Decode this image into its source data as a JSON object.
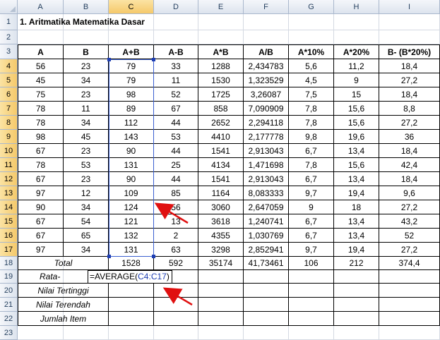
{
  "columns": [
    "A",
    "B",
    "C",
    "D",
    "E",
    "F",
    "G",
    "H",
    "I"
  ],
  "rows": [
    "1",
    "2",
    "3",
    "4",
    "5",
    "6",
    "7",
    "8",
    "9",
    "10",
    "11",
    "12",
    "13",
    "14",
    "15",
    "16",
    "17",
    "18",
    "19",
    "20",
    "21",
    "22",
    "23"
  ],
  "title": "1. Aritmatika Matematika Dasar",
  "table_headers": [
    "A",
    "B",
    "A+B",
    "A-B",
    "A*B",
    "A/B",
    "A*10%",
    "A*20%",
    "B- (B*20%)"
  ],
  "table_rows": [
    [
      "56",
      "23",
      "79",
      "33",
      "1288",
      "2,434783",
      "5,6",
      "11,2",
      "18,4"
    ],
    [
      "45",
      "34",
      "79",
      "11",
      "1530",
      "1,323529",
      "4,5",
      "9",
      "27,2"
    ],
    [
      "75",
      "23",
      "98",
      "52",
      "1725",
      "3,26087",
      "7,5",
      "15",
      "18,4"
    ],
    [
      "78",
      "11",
      "89",
      "67",
      "858",
      "7,090909",
      "7,8",
      "15,6",
      "8,8"
    ],
    [
      "78",
      "34",
      "112",
      "44",
      "2652",
      "2,294118",
      "7,8",
      "15,6",
      "27,2"
    ],
    [
      "98",
      "45",
      "143",
      "53",
      "4410",
      "2,177778",
      "9,8",
      "19,6",
      "36"
    ],
    [
      "67",
      "23",
      "90",
      "44",
      "1541",
      "2,913043",
      "6,7",
      "13,4",
      "18,4"
    ],
    [
      "78",
      "53",
      "131",
      "25",
      "4134",
      "1,471698",
      "7,8",
      "15,6",
      "42,4"
    ],
    [
      "67",
      "23",
      "90",
      "44",
      "1541",
      "2,913043",
      "6,7",
      "13,4",
      "18,4"
    ],
    [
      "97",
      "12",
      "109",
      "85",
      "1164",
      "8,083333",
      "9,7",
      "19,4",
      "9,6"
    ],
    [
      "90",
      "34",
      "124",
      "56",
      "3060",
      "2,647059",
      "9",
      "18",
      "27,2"
    ],
    [
      "67",
      "54",
      "121",
      "13",
      "3618",
      "1,240741",
      "6,7",
      "13,4",
      "43,2"
    ],
    [
      "67",
      "65",
      "132",
      "2",
      "4355",
      "1,030769",
      "6,7",
      "13,4",
      "52"
    ],
    [
      "97",
      "34",
      "131",
      "63",
      "3298",
      "2,852941",
      "9,7",
      "19,4",
      "27,2"
    ]
  ],
  "total_row": [
    "Total",
    "",
    "1528",
    "592",
    "35174",
    "41,73461",
    "106",
    "212",
    "374,4"
  ],
  "summary_labels": [
    "Rata-",
    "Nilai Tertinggi",
    "Nilai Terendah",
    "Jumlah Item"
  ],
  "formula": {
    "prefix": "=AVERAGE(",
    "range": "C4:C17",
    "suffix": ")"
  },
  "colors": {
    "selection": "#1f3fb3",
    "arrow": "#e01010"
  }
}
